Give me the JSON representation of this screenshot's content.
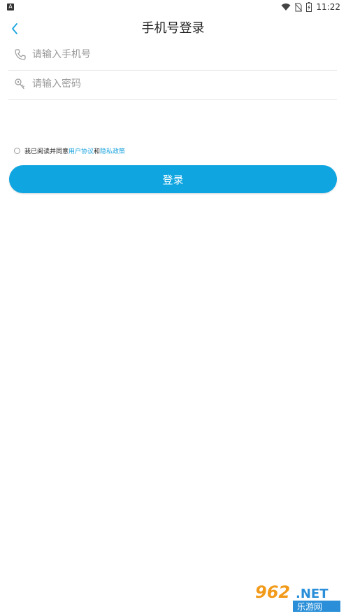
{
  "status_bar": {
    "left_icon_letter": "A",
    "time": "11:22",
    "icons": [
      "wifi-icon",
      "no-sim-icon",
      "battery-charging-icon"
    ]
  },
  "header": {
    "title": "手机号登录",
    "back_icon": "chevron-left-icon"
  },
  "form": {
    "phone": {
      "icon": "phone-icon",
      "placeholder": "请输入手机号",
      "value": ""
    },
    "password": {
      "icon": "key-icon",
      "placeholder": "请输入密码",
      "value": ""
    }
  },
  "agreement": {
    "checked": false,
    "prefix": "我已阅读并同意",
    "user_agreement": "用户协议",
    "conjunction": "和",
    "privacy_policy": "隐私政策"
  },
  "login_button": {
    "label": "登录"
  },
  "watermark": {
    "brand": "962.NET",
    "subtitle": "乐游网"
  },
  "colors": {
    "accent": "#0ea5e0",
    "link": "#1aa3df",
    "divider": "#e8e8e8",
    "placeholder": "#9a9a9a"
  }
}
